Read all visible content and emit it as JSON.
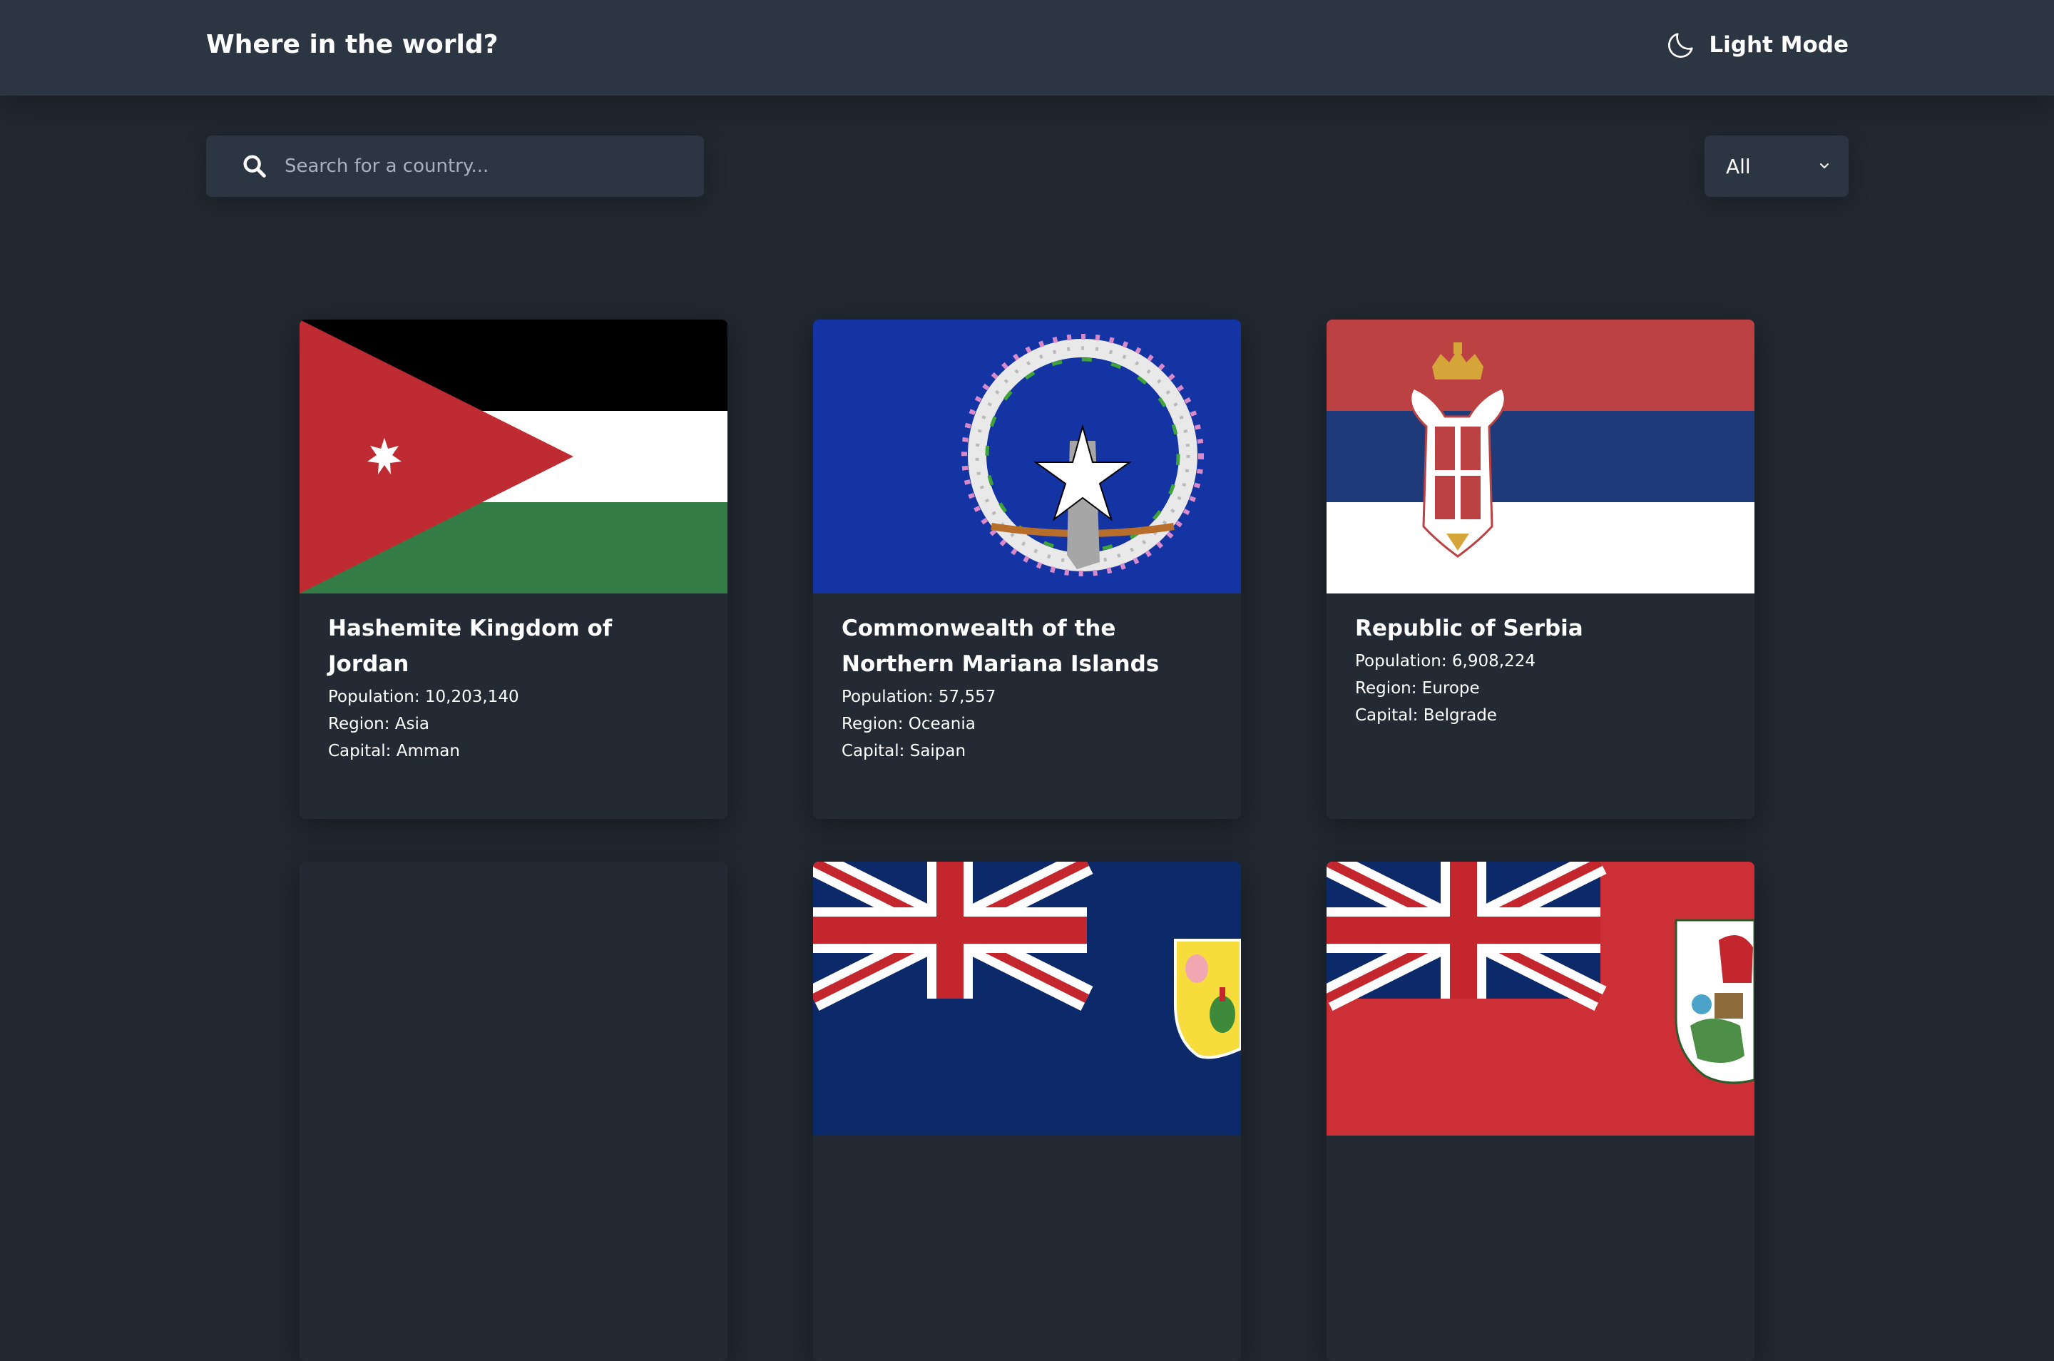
{
  "header": {
    "title": "Where in the world?",
    "mode_label": "Light Mode",
    "mode_icon": "moon-icon"
  },
  "search": {
    "placeholder": "Search for a country...",
    "value": "",
    "icon": "search-icon"
  },
  "filter": {
    "selected": "All",
    "icon": "chevron-down-icon"
  },
  "labels": {
    "population": "Population: ",
    "region": "Region: ",
    "capital": "Capital: "
  },
  "countries": [
    {
      "name": "Hashemite Kingdom of Jordan",
      "population": "10,203,140",
      "region": "Asia",
      "capital": "Amman",
      "flag": "jordan-flag"
    },
    {
      "name": "Commonwealth of the Northern Mariana Islands",
      "population": "57,557",
      "region": "Oceania",
      "capital": "Saipan",
      "flag": "northern-mariana-islands-flag"
    },
    {
      "name": "Republic of Serbia",
      "population": "6,908,224",
      "region": "Europe",
      "capital": "Belgrade",
      "flag": "serbia-flag"
    },
    {
      "name": "",
      "population": "",
      "region": "",
      "capital": "",
      "flag": ""
    },
    {
      "name": "",
      "population": "",
      "region": "",
      "capital": "",
      "flag": "turks-and-caicos-flag"
    },
    {
      "name": "",
      "population": "",
      "region": "",
      "capital": "",
      "flag": "bermuda-flag"
    }
  ],
  "colors": {
    "background": "#212830",
    "elements": "#2c3542",
    "card": "#232a34",
    "text": "#ffffff"
  }
}
